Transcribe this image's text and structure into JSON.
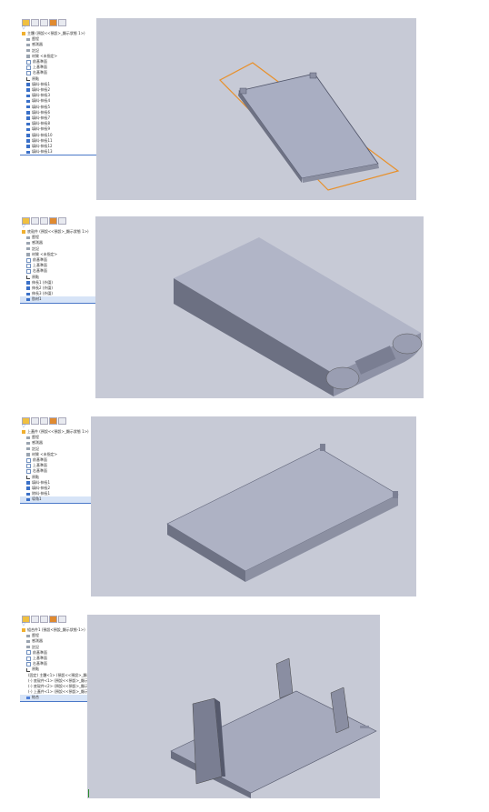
{
  "panels": [
    {
      "id": "panel-1",
      "tree": [
        {
          "text": "主體 (預設<<預設>_顯示狀態 1>)",
          "icon": "part-icon",
          "indent": 0,
          "selected": false
        },
        {
          "text": "歷程",
          "icon": "folder-icon",
          "indent": 1
        },
        {
          "text": "感測器",
          "icon": "folder-icon",
          "indent": 1
        },
        {
          "text": "註記",
          "icon": "folder-icon",
          "indent": 1
        },
        {
          "text": "材質 <未指定>",
          "icon": "folder-icon",
          "indent": 1
        },
        {
          "text": "前基準面",
          "icon": "plane-icon",
          "indent": 1
        },
        {
          "text": "上基準面",
          "icon": "plane-icon",
          "indent": 1
        },
        {
          "text": "右基準面",
          "icon": "plane-icon",
          "indent": 1
        },
        {
          "text": "原點",
          "icon": "origin-icon",
          "indent": 1
        },
        {
          "text": "填料-伸長1",
          "icon": "feature-icon",
          "indent": 1
        },
        {
          "text": "填料-伸長2",
          "icon": "feature-icon",
          "indent": 1
        },
        {
          "text": "填料-伸長3",
          "icon": "feature-icon",
          "indent": 1
        },
        {
          "text": "填料-伸長4",
          "icon": "feature-icon",
          "indent": 1
        },
        {
          "text": "填料-伸長5",
          "icon": "feature-icon",
          "indent": 1
        },
        {
          "text": "填料-伸長6",
          "icon": "feature-icon",
          "indent": 1
        },
        {
          "text": "填料-伸長7",
          "icon": "feature-icon",
          "indent": 1
        },
        {
          "text": "填料-伸長8",
          "icon": "feature-icon",
          "indent": 1
        },
        {
          "text": "填料-伸長9",
          "icon": "feature-icon",
          "indent": 1
        },
        {
          "text": "填料-伸長10",
          "icon": "feature-icon",
          "indent": 1
        },
        {
          "text": "填料-伸長11",
          "icon": "feature-icon",
          "indent": 1
        },
        {
          "text": "填料-伸長12",
          "icon": "feature-icon",
          "indent": 1
        },
        {
          "text": "填料-伸長13",
          "icon": "feature-icon",
          "indent": 1
        }
      ]
    },
    {
      "id": "panel-2",
      "tree": [
        {
          "text": "底殼件 (預設<<預設>_顯示狀態 1>)",
          "icon": "part-icon",
          "indent": 0
        },
        {
          "text": "歷程",
          "icon": "folder-icon",
          "indent": 1
        },
        {
          "text": "感測器",
          "icon": "folder-icon",
          "indent": 1
        },
        {
          "text": "註記",
          "icon": "folder-icon",
          "indent": 1
        },
        {
          "text": "材質 <未指定>",
          "icon": "folder-icon",
          "indent": 1
        },
        {
          "text": "前基準面",
          "icon": "plane-icon",
          "indent": 1
        },
        {
          "text": "上基準面",
          "icon": "plane-icon",
          "indent": 1
        },
        {
          "text": "右基準面",
          "icon": "plane-icon",
          "indent": 1
        },
        {
          "text": "原點",
          "icon": "origin-icon",
          "indent": 1
        },
        {
          "text": "伸長1 (外圍)",
          "icon": "feature-icon",
          "indent": 1
        },
        {
          "text": "伸長2 (外圍)",
          "icon": "feature-icon",
          "indent": 1
        },
        {
          "text": "伸長3 (外圍)",
          "icon": "feature-icon",
          "indent": 1
        },
        {
          "text": "肋材1",
          "icon": "feature-icon",
          "indent": 1,
          "selected": true
        }
      ]
    },
    {
      "id": "panel-3",
      "tree": [
        {
          "text": "上蓋件 (預設<<預設>_顯示狀態 1>)",
          "icon": "part-icon",
          "indent": 0
        },
        {
          "text": "歷程",
          "icon": "folder-icon",
          "indent": 1
        },
        {
          "text": "感測器",
          "icon": "folder-icon",
          "indent": 1
        },
        {
          "text": "註記",
          "icon": "folder-icon",
          "indent": 1
        },
        {
          "text": "材質 <未指定>",
          "icon": "folder-icon",
          "indent": 1
        },
        {
          "text": "前基準面",
          "icon": "plane-icon",
          "indent": 1
        },
        {
          "text": "上基準面",
          "icon": "plane-icon",
          "indent": 1
        },
        {
          "text": "右基準面",
          "icon": "plane-icon",
          "indent": 1
        },
        {
          "text": "原點",
          "icon": "origin-icon",
          "indent": 1
        },
        {
          "text": "填料-伸長1",
          "icon": "feature-icon",
          "indent": 1
        },
        {
          "text": "填料-伸長2",
          "icon": "feature-icon",
          "indent": 1
        },
        {
          "text": "除料-伸長1",
          "icon": "feature-icon",
          "indent": 1
        },
        {
          "text": "導角1",
          "icon": "feature-icon",
          "indent": 1,
          "selected": true
        }
      ]
    },
    {
      "id": "panel-4",
      "tree": [
        {
          "text": "組合件1 (預設<預設_顯示狀態-1>)",
          "icon": "part-icon",
          "indent": 0
        },
        {
          "text": "歷程",
          "icon": "folder-icon",
          "indent": 1
        },
        {
          "text": "感測器",
          "icon": "folder-icon",
          "indent": 1
        },
        {
          "text": "註記",
          "icon": "folder-icon",
          "indent": 1
        },
        {
          "text": "前基準面",
          "icon": "plane-icon",
          "indent": 1
        },
        {
          "text": "上基準面",
          "icon": "plane-icon",
          "indent": 1
        },
        {
          "text": "右基準面",
          "icon": "plane-icon",
          "indent": 1
        },
        {
          "text": "原點",
          "icon": "origin-icon",
          "indent": 1
        },
        {
          "text": "(固定) 主體<1> (預設<<預設>_顯示...",
          "icon": "part-icon",
          "indent": 1
        },
        {
          "text": "(-) 底殼件<1> (預設<<預設>_顯示...",
          "icon": "part-icon",
          "indent": 1
        },
        {
          "text": "(-) 底殼件<2> (預設<<預設>_顯示...",
          "icon": "part-icon",
          "indent": 1
        },
        {
          "text": "(-) 上蓋件<1> (預設<<預設>_顯示...",
          "icon": "part-icon",
          "indent": 1
        },
        {
          "text": "結合",
          "icon": "mate-icon",
          "indent": 1,
          "selected": true
        }
      ]
    }
  ]
}
